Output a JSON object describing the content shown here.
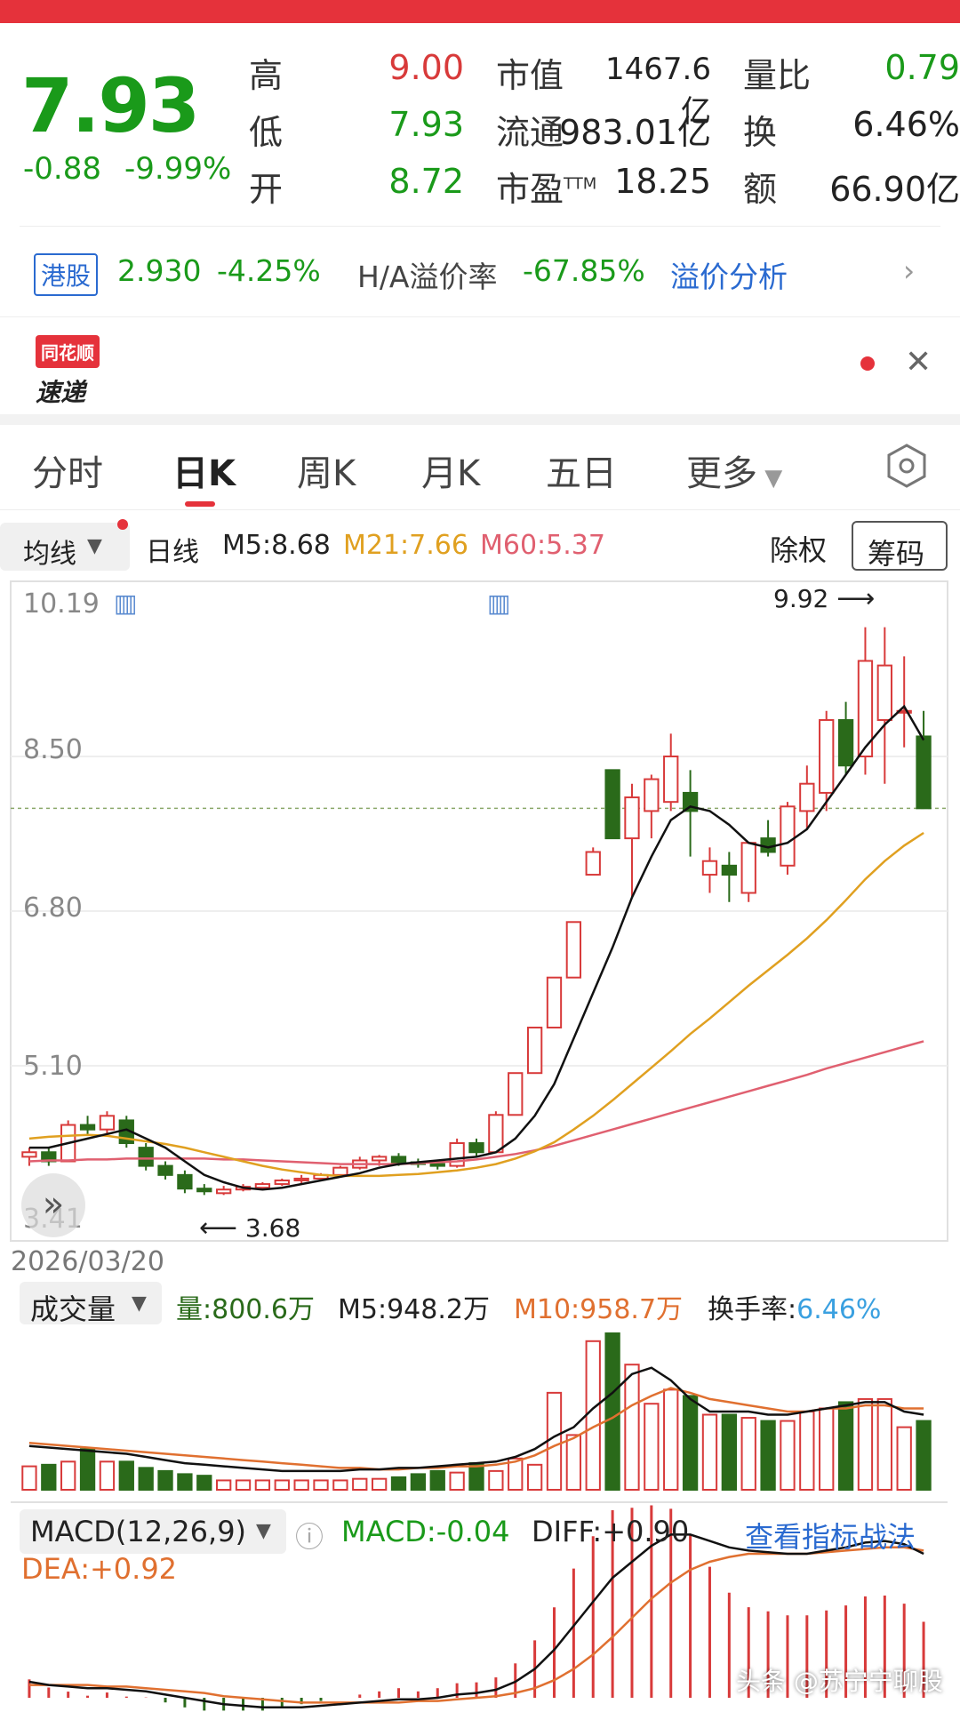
{
  "quote": {
    "price": "7.93",
    "change": "-0.88",
    "change_pct": "-9.99%",
    "high_label": "高",
    "high_value": "9.00",
    "low_label": "低",
    "low_value": "7.93",
    "open_label": "开",
    "open_value": "8.72",
    "mktcap_label": "市值",
    "mktcap_value": "1467.6亿",
    "float_label": "流通",
    "float_value": "983.01亿",
    "pe_label": "市盈",
    "pe_sup": "TTM",
    "pe_value": "18.25",
    "vr_label": "量比",
    "vr_value": "0.79",
    "turnover_label": "换",
    "turnover_value": "6.46%",
    "amount_label": "额",
    "amount_value": "66.90亿"
  },
  "hk": {
    "tag": "港股",
    "price": "2.930",
    "pct": "-4.25%",
    "premium_label": "H/A溢价率",
    "premium_value": "-67.85%",
    "link": "溢价分析"
  },
  "news": {
    "logo_line1": "同花顺",
    "logo_line2": "速递"
  },
  "tabs": [
    "分时",
    "日K",
    "周K",
    "月K",
    "五日",
    "更多"
  ],
  "indicator_bar": {
    "ma_label": "均线",
    "period": "日线",
    "m5": "M5:8.68",
    "m21": "M21:7.66",
    "m60": "M60:5.37",
    "adjust": "除权",
    "chip": "筹码"
  },
  "price_axis": [
    "10.19",
    "8.50",
    "6.80",
    "5.10",
    "3.41"
  ],
  "date_label": "2026/03/20",
  "annot_high": "9.92",
  "annot_low": "3.68",
  "volume": {
    "label": "成交量",
    "vol": "量:800.6万",
    "m5": "M5:948.2万",
    "m10": "M10:958.7万",
    "turnover_label": "换手率:",
    "turnover_value": "6.46%"
  },
  "macd": {
    "label": "MACD(12,26,9)",
    "macd": "MACD:-0.04",
    "diff": "DIFF:+0.90",
    "dea": "DEA:+0.92",
    "link": "查看指标战法"
  },
  "watermark": "头条 @苏宁宁聊股",
  "colors": {
    "up": "#d83a3a",
    "down": "#2a6a1a",
    "ma5": "#111111",
    "ma21": "#e0a020",
    "ma60": "#e06070",
    "accent": "#e5323b",
    "link": "#2a6ad0"
  },
  "chart_data": {
    "type": "candlestick",
    "ylim": [
      3.41,
      10.19
    ],
    "high_annotation": 9.92,
    "low_annotation": 3.68,
    "candles": [
      [
        4.1,
        4.2,
        4.0,
        4.15
      ],
      [
        4.15,
        4.2,
        4.0,
        4.05
      ],
      [
        4.05,
        4.5,
        4.05,
        4.45
      ],
      [
        4.45,
        4.55,
        4.35,
        4.4
      ],
      [
        4.4,
        4.6,
        4.35,
        4.55
      ],
      [
        4.5,
        4.55,
        4.2,
        4.25
      ],
      [
        4.2,
        4.25,
        3.95,
        4.0
      ],
      [
        4.0,
        4.05,
        3.85,
        3.9
      ],
      [
        3.9,
        3.95,
        3.7,
        3.75
      ],
      [
        3.75,
        3.8,
        3.68,
        3.72
      ],
      [
        3.7,
        3.78,
        3.68,
        3.74
      ],
      [
        3.74,
        3.8,
        3.72,
        3.77
      ],
      [
        3.76,
        3.82,
        3.74,
        3.8
      ],
      [
        3.8,
        3.86,
        3.78,
        3.84
      ],
      [
        3.84,
        3.9,
        3.8,
        3.86
      ],
      [
        3.86,
        3.92,
        3.84,
        3.9
      ],
      [
        3.9,
        4.0,
        3.88,
        3.98
      ],
      [
        3.98,
        4.1,
        3.96,
        4.06
      ],
      [
        4.06,
        4.12,
        4.0,
        4.1
      ],
      [
        4.1,
        4.14,
        4.0,
        4.04
      ],
      [
        4.04,
        4.08,
        3.98,
        4.02
      ],
      [
        4.02,
        4.06,
        3.96,
        4.0
      ],
      [
        4.0,
        4.3,
        3.98,
        4.25
      ],
      [
        4.25,
        4.3,
        4.1,
        4.15
      ],
      [
        4.15,
        4.6,
        4.15,
        4.56
      ],
      [
        4.56,
        5.02,
        4.56,
        5.02
      ],
      [
        5.02,
        5.52,
        5.02,
        5.52
      ],
      [
        5.52,
        6.07,
        5.52,
        6.07
      ],
      [
        6.07,
        6.68,
        6.07,
        6.68
      ],
      [
        7.2,
        7.5,
        7.2,
        7.45
      ],
      [
        8.35,
        8.35,
        7.6,
        7.6
      ],
      [
        7.6,
        8.2,
        6.95,
        8.05
      ],
      [
        7.9,
        8.3,
        7.6,
        8.25
      ],
      [
        8.0,
        8.75,
        7.9,
        8.5
      ],
      [
        8.1,
        8.35,
        7.4,
        7.9
      ],
      [
        7.2,
        7.5,
        7.0,
        7.35
      ],
      [
        7.3,
        7.45,
        6.9,
        7.2
      ],
      [
        7.0,
        7.5,
        6.9,
        7.55
      ],
      [
        7.6,
        7.8,
        7.4,
        7.45
      ],
      [
        7.3,
        8.0,
        7.2,
        7.95
      ],
      [
        7.9,
        8.4,
        7.7,
        8.2
      ],
      [
        8.1,
        9.0,
        7.9,
        8.9
      ],
      [
        8.9,
        9.1,
        8.3,
        8.4
      ],
      [
        8.5,
        9.92,
        8.3,
        9.55
      ],
      [
        8.9,
        9.92,
        8.2,
        9.5
      ],
      [
        9.0,
        9.6,
        8.6,
        9.0
      ],
      [
        8.72,
        9.0,
        7.93,
        7.93
      ]
    ],
    "ma5": [
      4.2,
      4.2,
      4.25,
      4.3,
      4.35,
      4.4,
      4.3,
      4.2,
      4.05,
      3.9,
      3.82,
      3.76,
      3.74,
      3.76,
      3.8,
      3.84,
      3.88,
      3.92,
      3.98,
      4.02,
      4.04,
      4.06,
      4.08,
      4.1,
      4.15,
      4.3,
      4.55,
      4.9,
      5.4,
      5.9,
      6.4,
      6.95,
      7.4,
      7.8,
      7.95,
      7.9,
      7.75,
      7.55,
      7.5,
      7.55,
      7.7,
      8.0,
      8.3,
      8.6,
      8.85,
      9.05,
      8.68
    ],
    "ma21": [
      4.3,
      4.32,
      4.33,
      4.34,
      4.33,
      4.3,
      4.27,
      4.24,
      4.2,
      4.15,
      4.1,
      4.05,
      4.0,
      3.96,
      3.93,
      3.9,
      3.89,
      3.89,
      3.89,
      3.9,
      3.91,
      3.93,
      3.95,
      3.98,
      4.02,
      4.08,
      4.16,
      4.26,
      4.4,
      4.55,
      4.72,
      4.9,
      5.08,
      5.26,
      5.45,
      5.62,
      5.8,
      5.98,
      6.15,
      6.32,
      6.5,
      6.7,
      6.92,
      7.15,
      7.35,
      7.52,
      7.66
    ],
    "ma60": [
      4.05,
      4.06,
      4.06,
      4.07,
      4.07,
      4.08,
      4.08,
      4.08,
      4.08,
      4.08,
      4.07,
      4.07,
      4.06,
      4.05,
      4.04,
      4.03,
      4.02,
      4.02,
      4.02,
      4.02,
      4.03,
      4.04,
      4.05,
      4.07,
      4.1,
      4.13,
      4.17,
      4.22,
      4.28,
      4.34,
      4.4,
      4.46,
      4.52,
      4.58,
      4.64,
      4.7,
      4.76,
      4.82,
      4.88,
      4.94,
      5.0,
      5.07,
      5.13,
      5.19,
      5.25,
      5.31,
      5.37
    ],
    "volume_index": [
      0.15,
      0.16,
      0.18,
      0.26,
      0.18,
      0.18,
      0.14,
      0.12,
      0.1,
      0.09,
      0.06,
      0.06,
      0.06,
      0.06,
      0.06,
      0.06,
      0.06,
      0.07,
      0.07,
      0.08,
      0.1,
      0.12,
      0.11,
      0.17,
      0.12,
      0.2,
      0.16,
      0.62,
      0.35,
      0.95,
      1.0,
      0.8,
      0.55,
      0.64,
      0.6,
      0.48,
      0.48,
      0.46,
      0.44,
      0.44,
      0.5,
      0.52,
      0.56,
      0.58,
      0.58,
      0.4,
      0.44
    ],
    "volume_ma5": [
      0.28,
      0.27,
      0.26,
      0.25,
      0.24,
      0.23,
      0.21,
      0.19,
      0.17,
      0.16,
      0.15,
      0.14,
      0.13,
      0.12,
      0.12,
      0.12,
      0.12,
      0.13,
      0.13,
      0.14,
      0.14,
      0.15,
      0.16,
      0.17,
      0.18,
      0.21,
      0.26,
      0.34,
      0.4,
      0.52,
      0.62,
      0.74,
      0.78,
      0.7,
      0.58,
      0.5,
      0.5,
      0.5,
      0.48,
      0.48,
      0.5,
      0.52,
      0.54,
      0.56,
      0.56,
      0.5,
      0.48
    ],
    "volume_ma10": [
      0.3,
      0.29,
      0.28,
      0.27,
      0.26,
      0.25,
      0.24,
      0.23,
      0.22,
      0.21,
      0.2,
      0.19,
      0.18,
      0.17,
      0.16,
      0.15,
      0.14,
      0.14,
      0.13,
      0.13,
      0.14,
      0.14,
      0.15,
      0.15,
      0.16,
      0.18,
      0.22,
      0.28,
      0.33,
      0.4,
      0.46,
      0.54,
      0.6,
      0.65,
      0.62,
      0.58,
      0.56,
      0.54,
      0.52,
      0.5,
      0.5,
      0.52,
      0.52,
      0.54,
      0.54,
      0.52,
      0.52
    ],
    "macd_diff": [
      0.1,
      0.08,
      0.07,
      0.06,
      0.06,
      0.05,
      0.04,
      0.02,
      0.0,
      -0.02,
      -0.04,
      -0.05,
      -0.06,
      -0.06,
      -0.06,
      -0.05,
      -0.04,
      -0.03,
      -0.02,
      -0.01,
      -0.01,
      -0.0,
      0.02,
      0.03,
      0.05,
      0.1,
      0.18,
      0.3,
      0.45,
      0.6,
      0.75,
      0.85,
      0.95,
      1.02,
      1.02,
      0.98,
      0.94,
      0.92,
      0.91,
      0.9,
      0.9,
      0.92,
      0.94,
      0.97,
      0.98,
      0.96,
      0.9
    ],
    "macd_dea": [
      0.08,
      0.08,
      0.08,
      0.08,
      0.07,
      0.07,
      0.06,
      0.05,
      0.04,
      0.03,
      0.01,
      0.0,
      -0.01,
      -0.02,
      -0.03,
      -0.03,
      -0.03,
      -0.03,
      -0.03,
      -0.03,
      -0.02,
      -0.02,
      -0.01,
      0.0,
      0.01,
      0.03,
      0.06,
      0.11,
      0.18,
      0.27,
      0.38,
      0.5,
      0.62,
      0.72,
      0.8,
      0.85,
      0.88,
      0.9,
      0.9,
      0.9,
      0.9,
      0.91,
      0.92,
      0.93,
      0.94,
      0.94,
      0.92
    ]
  }
}
